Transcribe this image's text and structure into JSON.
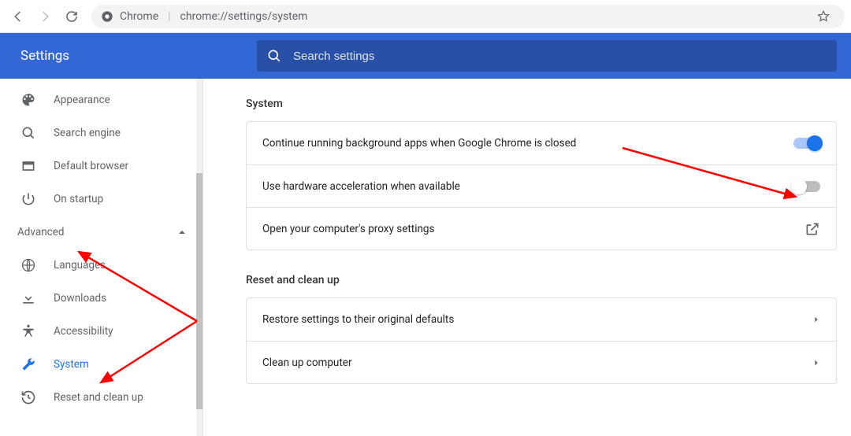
{
  "browser": {
    "app_label": "Chrome",
    "url": "chrome://settings/system"
  },
  "header": {
    "title": "Settings",
    "search_placeholder": "Search settings"
  },
  "sidebar": {
    "items_top": [
      {
        "id": "appearance",
        "label": "Appearance"
      },
      {
        "id": "search-engine",
        "label": "Search engine"
      },
      {
        "id": "default-browser",
        "label": "Default browser"
      },
      {
        "id": "on-startup",
        "label": "On startup"
      }
    ],
    "advanced_label": "Advanced",
    "advanced_expanded": true,
    "items_advanced": [
      {
        "id": "languages",
        "label": "Languages"
      },
      {
        "id": "downloads",
        "label": "Downloads"
      },
      {
        "id": "accessibility",
        "label": "Accessibility"
      },
      {
        "id": "system",
        "label": "System",
        "active": true
      },
      {
        "id": "reset",
        "label": "Reset and clean up"
      }
    ]
  },
  "content": {
    "system_title": "System",
    "system_rows": {
      "bg_apps": "Continue running background apps when Google Chrome is closed",
      "hw_accel": "Use hardware acceleration when available",
      "proxy": "Open your computer's proxy settings"
    },
    "toggles": {
      "bg_apps": true,
      "hw_accel": false
    },
    "reset_title": "Reset and clean up",
    "reset_rows": {
      "restore": "Restore settings to their original defaults",
      "cleanup": "Clean up computer"
    }
  }
}
